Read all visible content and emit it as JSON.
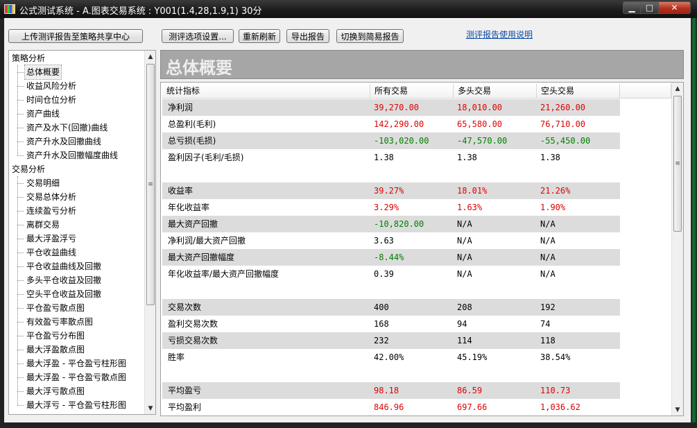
{
  "window": {
    "title": "公式测试系统 - A.图表交易系统 : Y001(1.4,28,1.9,1) 30分",
    "minimize": "▁",
    "maximize": "□",
    "close": "✕"
  },
  "toolbar": {
    "upload": "上传测评报告至策略共享中心",
    "options": "测评选项设置...",
    "refresh": "重新刷新",
    "export": "导出报告",
    "switch": "切换到简易报告",
    "help_link": "测评报告使用说明"
  },
  "tree": {
    "groups": [
      {
        "label": "策略分析",
        "items": [
          "总体概要",
          "收益风险分析",
          "时间仓位分析",
          "资产曲线",
          "资产及水下(回撤)曲线",
          "资产升水及回撤曲线",
          "资产升水及回撤幅度曲线"
        ]
      },
      {
        "label": "交易分析",
        "items": [
          "交易明细",
          "交易总体分析",
          "连续盈亏分析",
          "离群交易",
          "最大浮盈浮亏",
          "平仓收益曲线",
          "平仓收益曲线及回撤",
          "多头平仓收益及回撤",
          "空头平仓收益及回撤",
          "平仓盈亏散点图",
          "有效盈亏率散点图",
          "平仓盈亏分布图",
          "最大浮盈散点图",
          "最大浮盈 - 平仓盈亏柱形图",
          "最大浮盈 - 平仓盈亏散点图",
          "最大浮亏散点图",
          "最大浮亏 - 平仓盈亏柱形图"
        ]
      }
    ],
    "selected": "总体概要"
  },
  "report": {
    "title": "总体概要",
    "columns": [
      "统计指标",
      "所有交易",
      "多头交易",
      "空头交易"
    ],
    "rows": [
      {
        "label": "净利润",
        "v": [
          "39,270.00",
          "18,010.00",
          "21,260.00"
        ],
        "c": [
          "pos",
          "pos",
          "pos"
        ],
        "shaded": true
      },
      {
        "label": "总盈利(毛利)",
        "v": [
          "142,290.00",
          "65,580.00",
          "76,710.00"
        ],
        "c": [
          "pos",
          "pos",
          "pos"
        ],
        "shaded": false
      },
      {
        "label": "总亏损(毛损)",
        "v": [
          "-103,020.00",
          "-47,570.00",
          "-55,450.00"
        ],
        "c": [
          "neg",
          "neg",
          "neg"
        ],
        "shaded": true
      },
      {
        "label": "盈利因子(毛利/毛损)",
        "v": [
          "1.38",
          "1.38",
          "1.38"
        ],
        "c": [
          "neu",
          "neu",
          "neu"
        ],
        "shaded": false
      },
      {
        "label": "",
        "v": [
          "",
          "",
          ""
        ],
        "c": [
          "neu",
          "neu",
          "neu"
        ],
        "shaded": false
      },
      {
        "label": "收益率",
        "v": [
          "39.27%",
          "18.01%",
          "21.26%"
        ],
        "c": [
          "pos",
          "pos",
          "pos"
        ],
        "shaded": true
      },
      {
        "label": "年化收益率",
        "v": [
          "3.29%",
          "1.63%",
          "1.90%"
        ],
        "c": [
          "pos",
          "pos",
          "pos"
        ],
        "shaded": false
      },
      {
        "label": "最大资产回撤",
        "v": [
          "-10,820.00",
          "N/A",
          "N/A"
        ],
        "c": [
          "neg",
          "neu",
          "neu"
        ],
        "shaded": true
      },
      {
        "label": "净利润/最大资产回撤",
        "v": [
          "3.63",
          "N/A",
          "N/A"
        ],
        "c": [
          "neu",
          "neu",
          "neu"
        ],
        "shaded": false
      },
      {
        "label": "最大资产回撤幅度",
        "v": [
          "-8.44%",
          "N/A",
          "N/A"
        ],
        "c": [
          "neg",
          "neu",
          "neu"
        ],
        "shaded": true
      },
      {
        "label": "年化收益率/最大资产回撤幅度",
        "v": [
          "0.39",
          "N/A",
          "N/A"
        ],
        "c": [
          "neu",
          "neu",
          "neu"
        ],
        "shaded": false
      },
      {
        "label": "",
        "v": [
          "",
          "",
          ""
        ],
        "c": [
          "neu",
          "neu",
          "neu"
        ],
        "shaded": false
      },
      {
        "label": "交易次数",
        "v": [
          "400",
          "208",
          "192"
        ],
        "c": [
          "neu",
          "neu",
          "neu"
        ],
        "shaded": true
      },
      {
        "label": "盈利交易次数",
        "v": [
          "168",
          "94",
          "74"
        ],
        "c": [
          "neu",
          "neu",
          "neu"
        ],
        "shaded": false
      },
      {
        "label": "亏损交易次数",
        "v": [
          "232",
          "114",
          "118"
        ],
        "c": [
          "neu",
          "neu",
          "neu"
        ],
        "shaded": true
      },
      {
        "label": "胜率",
        "v": [
          "42.00%",
          "45.19%",
          "38.54%"
        ],
        "c": [
          "neu",
          "neu",
          "neu"
        ],
        "shaded": false
      },
      {
        "label": "",
        "v": [
          "",
          "",
          ""
        ],
        "c": [
          "neu",
          "neu",
          "neu"
        ],
        "shaded": false
      },
      {
        "label": "平均盈亏",
        "v": [
          "98.18",
          "86.59",
          "110.73"
        ],
        "c": [
          "pos",
          "pos",
          "pos"
        ],
        "shaded": true
      },
      {
        "label": "平均盈利",
        "v": [
          "846.96",
          "697.66",
          "1,036.62"
        ],
        "c": [
          "pos",
          "pos",
          "pos"
        ],
        "shaded": false
      }
    ]
  },
  "colors": {
    "positive": "#e00000",
    "negative": "#008000",
    "row_shade": "#dcdcdc",
    "header_bar": "#a6a6a6"
  }
}
